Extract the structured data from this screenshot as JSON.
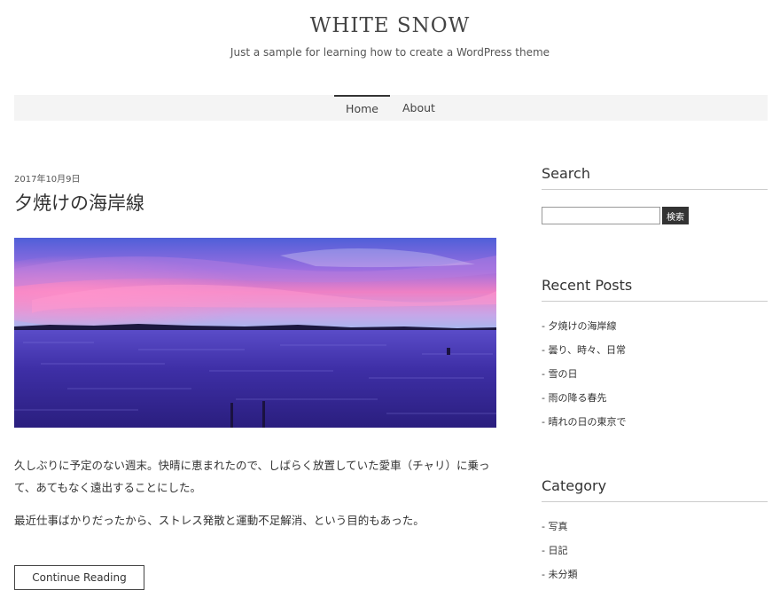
{
  "site": {
    "title": "WHITE SNOW",
    "description": "Just a sample for learning how to create a WordPress theme"
  },
  "nav": {
    "items": [
      {
        "label": "Home",
        "active": true
      },
      {
        "label": "About",
        "active": false
      }
    ]
  },
  "post": {
    "date": "2017年10月9日",
    "title": "夕焼けの海岸線",
    "paragraphs": [
      "久しぶりに予定のない週末。快晴に恵まれたので、しばらく放置していた愛車（チャリ）に乗って、あてもなく遠出することにした。",
      "最近仕事ばかりだったから、ストレス発散と運動不足解消、という目的もあった。"
    ],
    "read_more_label": "Continue Reading"
  },
  "sidebar": {
    "search": {
      "title": "Search",
      "input_value": "",
      "button_label": "検索"
    },
    "recent_posts": {
      "title": "Recent Posts",
      "items": [
        "- 夕焼けの海岸線",
        "- 曇り、時々、日常",
        "- 雪の日",
        "- 雨の降る春先",
        "- 晴れの日の東京で"
      ]
    },
    "category": {
      "title": "Category",
      "items": [
        "- 写真",
        "- 日記",
        "- 未分類"
      ]
    }
  },
  "colors": {
    "accent": "#333333",
    "nav_background": "#f4f4f4",
    "sky_top": "#5a4fc4",
    "sky_pink": "#f07ab8",
    "sea": "#3b2b9e"
  }
}
